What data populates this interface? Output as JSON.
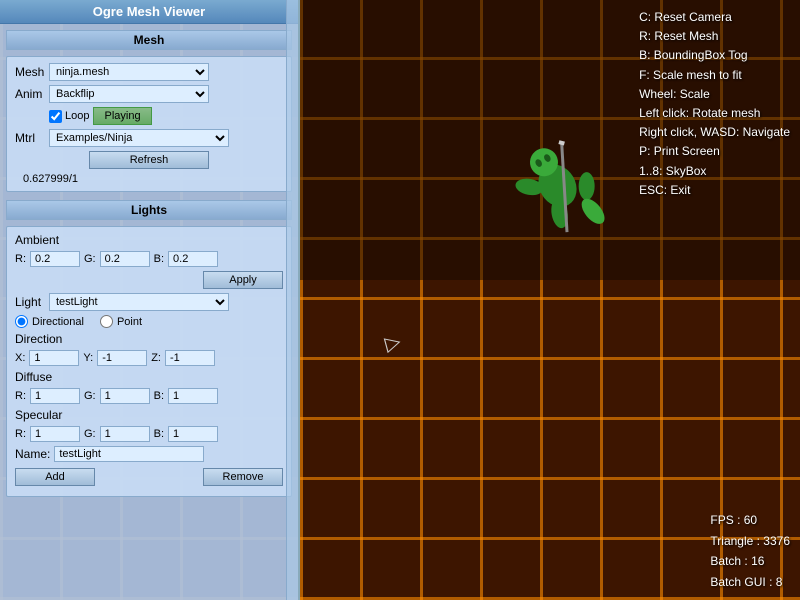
{
  "window": {
    "title": "Ogre Mesh Viewer"
  },
  "hud": {
    "topRight": [
      "C: Reset Camera",
      "R: Reset Mesh",
      "B: BoundingBox Tog",
      "F: Scale mesh to fit",
      "Wheel: Scale",
      "Left click: Rotate mesh",
      "Right click, WASD: Navigate",
      "P: Print Screen",
      "1..8: SkyBox",
      "ESC: Exit"
    ],
    "bottomRight": [
      "FPS : 60",
      "Triangle : 3376",
      "Batch : 16",
      "Batch GUI : 8"
    ]
  },
  "mesh": {
    "section_title": "Mesh",
    "mesh_label": "Mesh",
    "mesh_value": "ninja.mesh",
    "anim_label": "Anim",
    "anim_value": "Backflip",
    "loop_label": "Loop",
    "playing_label": "Playing",
    "mtrl_label": "Mtrl",
    "mtrl_value": "Examples/Ninja",
    "refresh_label": "Refresh",
    "progress": "0.627999/1"
  },
  "lights": {
    "section_title": "Lights",
    "ambient_label": "Ambient",
    "r_label": "R:",
    "g_label": "G:",
    "b_label": "B:",
    "ambient_r": "0.2",
    "ambient_g": "0.2",
    "ambient_b": "0.2",
    "apply_label": "Apply",
    "light_label": "Light",
    "light_value": "testLight",
    "directional_label": "Directional",
    "point_label": "Point",
    "direction_label": "Direction",
    "dir_x_label": "X:",
    "dir_y_label": "Y:",
    "dir_z_label": "Z:",
    "dir_x": "1",
    "dir_y": "-1",
    "dir_z": "-1",
    "diffuse_label": "Diffuse",
    "diff_r_label": "R:",
    "diff_g_label": "G:",
    "diff_b_label": "B:",
    "diff_r": "1",
    "diff_g": "1",
    "diff_b": "1",
    "specular_label": "Specular",
    "spec_r_label": "R:",
    "spec_g_label": "G:",
    "spec_b_label": "B:",
    "spec_r": "1",
    "spec_g": "1",
    "spec_b": "1",
    "name_label": "Name:",
    "name_value": "testLight",
    "add_label": "Add",
    "remove_label": "Remove"
  }
}
